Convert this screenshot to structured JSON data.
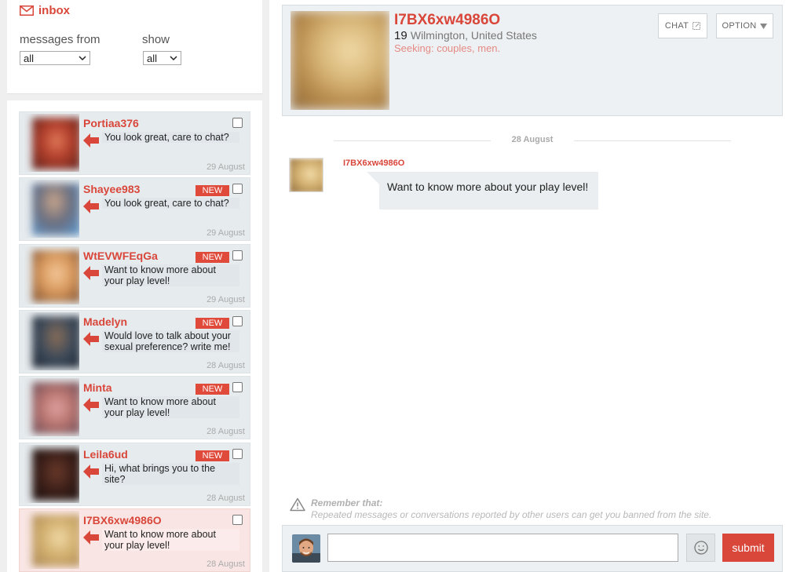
{
  "inbox": {
    "title": "inbox",
    "messages_from_label": "messages from",
    "messages_from_value": "all",
    "show_label": "show",
    "show_value": "all"
  },
  "conversations": [
    {
      "name": "Portiaa376",
      "message": "You look great, care to chat?",
      "date": "29 August",
      "is_new": false
    },
    {
      "name": "Shayee983",
      "message": "You look great, care to chat?",
      "date": "29 August",
      "is_new": true
    },
    {
      "name": "WtEVWFEqGa",
      "message": "Want to know more about your play level!",
      "date": "29 August",
      "is_new": true
    },
    {
      "name": "Madelyn",
      "message": "Would love to talk about your sexual preference? write me!",
      "date": "28 August",
      "is_new": true
    },
    {
      "name": "Minta",
      "message": "Want to know more about your play level!",
      "date": "28 August",
      "is_new": true
    },
    {
      "name": "Leila6ud",
      "message": "Hi, what brings you to the site?",
      "date": "28 August",
      "is_new": true
    },
    {
      "name": "I7BX6xw4986O",
      "message": "Want to know more about your play level!",
      "date": "28 August",
      "is_new": false
    }
  ],
  "new_badge": "NEW",
  "profile": {
    "name": "I7BX6xw4986O",
    "age": "19",
    "location": "Wilmington, United States",
    "seeking": "Seeking: couples, men.",
    "chat_label": "CHAT",
    "option_label": "OPTION"
  },
  "thread": {
    "day": "28 August",
    "sender": "I7BX6xw4986O",
    "message": "Want to know more about your play level!"
  },
  "warning": {
    "title": "Remember that:",
    "text": "Repeated messages or conversations reported by other users can get you banned from the site."
  },
  "composer": {
    "input_value": "",
    "submit_label": "submit"
  },
  "colors": {
    "accent": "#d9463a",
    "panel": "#eef1f3",
    "active_row": "#f9e6e4"
  }
}
